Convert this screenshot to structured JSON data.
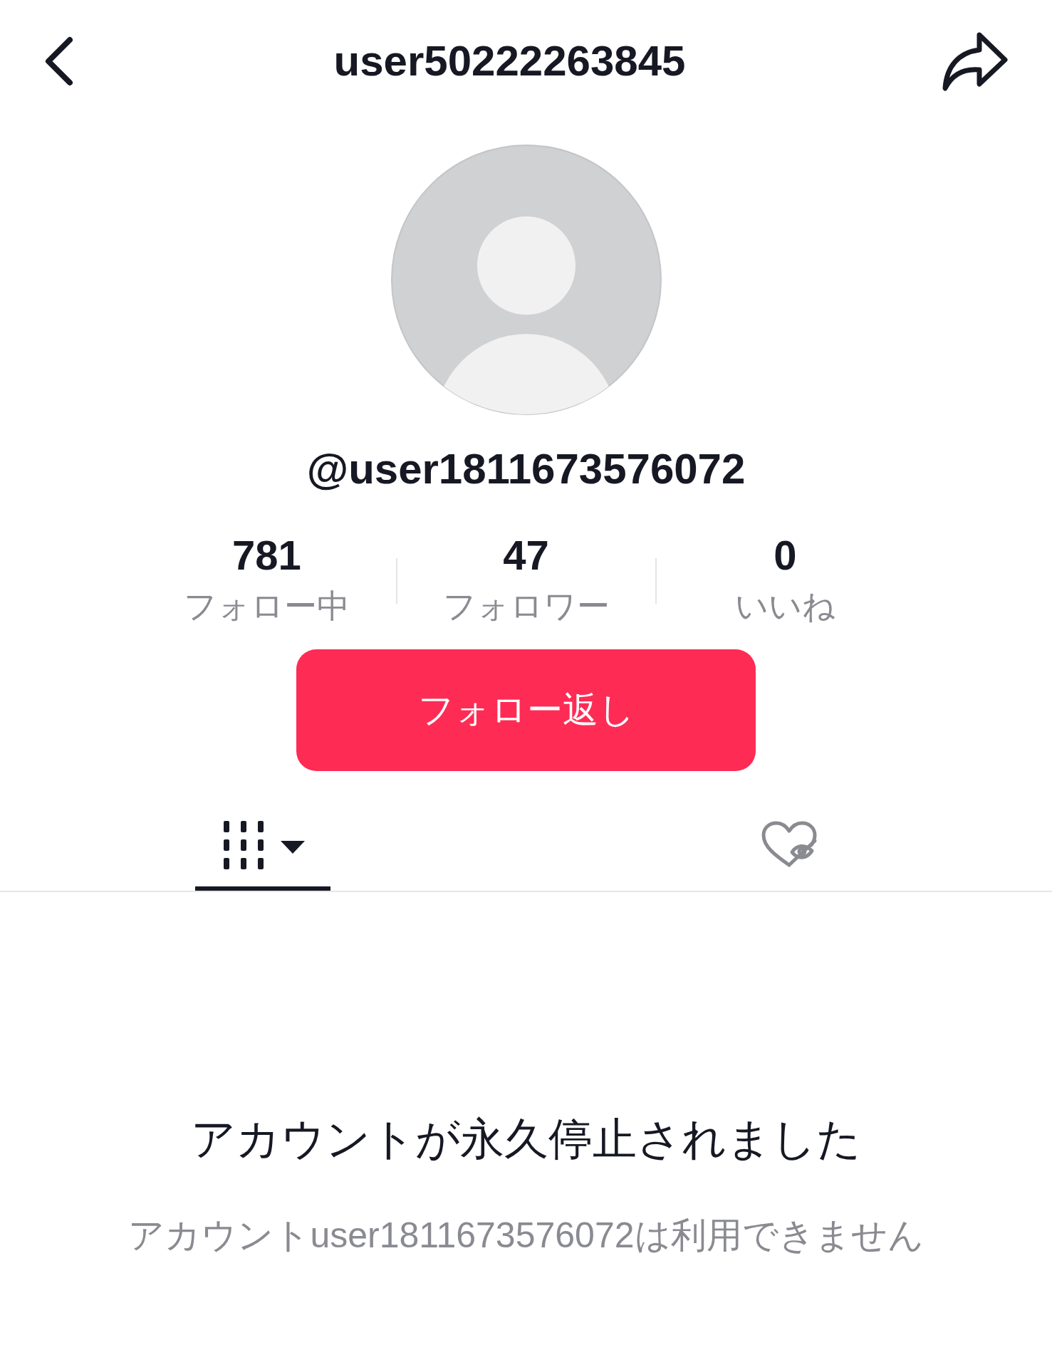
{
  "header": {
    "title": "user50222263845"
  },
  "profile": {
    "handle": "@user1811673576072"
  },
  "stats": [
    {
      "value": "781",
      "label": "フォロー中"
    },
    {
      "value": "47",
      "label": "フォロワー"
    },
    {
      "value": "0",
      "label": "いいね"
    }
  ],
  "follow_button": {
    "label": "フォロー返し"
  },
  "tabs": [
    {
      "kind": "videos",
      "selected": true
    },
    {
      "kind": "liked",
      "selected": false
    }
  ],
  "notice": {
    "title": "アカウントが永久停止されました",
    "subtitle": "アカウントuser1811673576072は利用できません"
  }
}
